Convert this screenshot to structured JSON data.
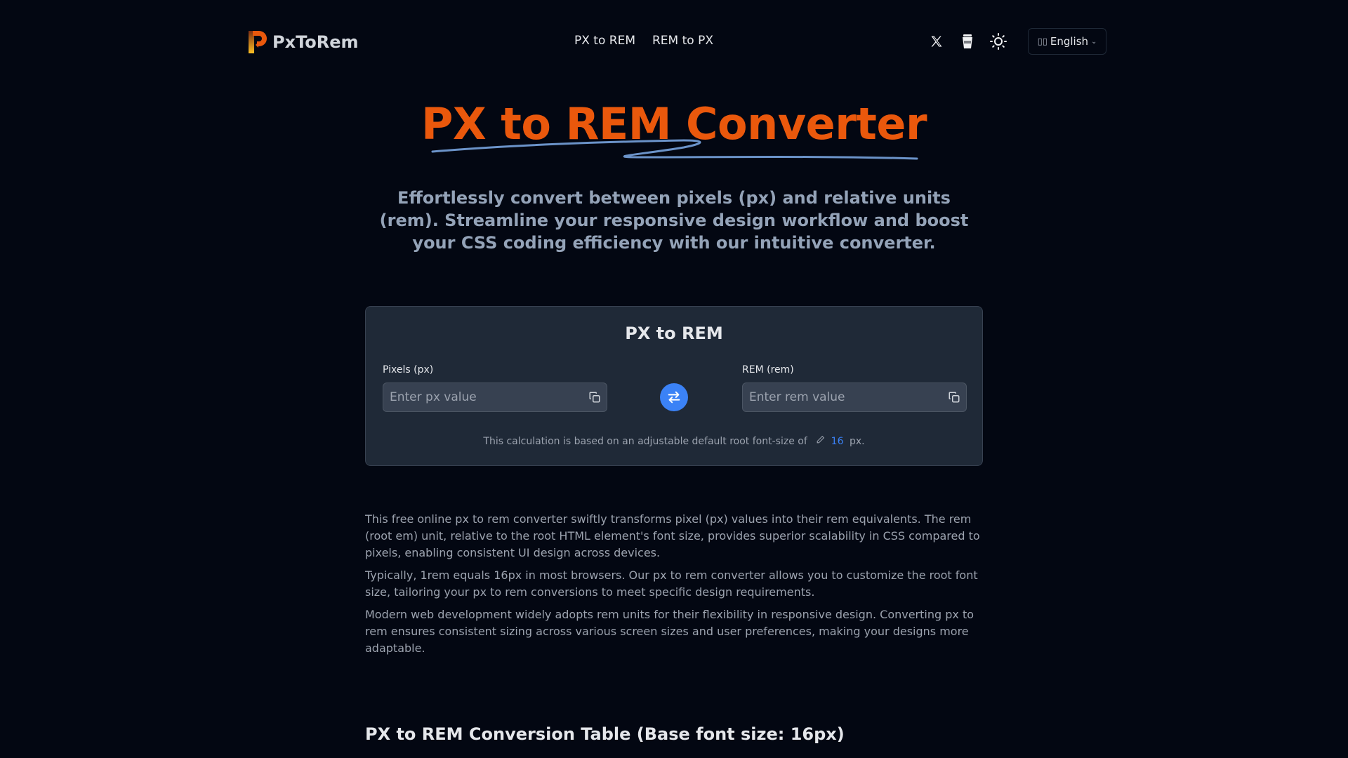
{
  "header": {
    "logo_text": "PxToRem",
    "nav": [
      "PX to REM",
      "REM to PX"
    ],
    "icons": [
      "x-twitter-icon",
      "coffee-cup-icon",
      "sun-icon"
    ],
    "language": "English"
  },
  "hero": {
    "title": "PX to REM Converter",
    "subtitle": "Effortlessly convert between pixels (px) and relative units (rem). Streamline your responsive design workflow and boost your CSS coding efficiency with our intuitive converter."
  },
  "converter": {
    "title": "PX to REM",
    "px_label": "Pixels (px)",
    "px_placeholder": "Enter px value",
    "px_value": "",
    "rem_label": "REM (rem)",
    "rem_placeholder": "Enter rem value",
    "rem_value": "",
    "note_prefix": "This calculation is based on an adjustable default root font-size of",
    "root_font_size": "16",
    "note_suffix": "px.",
    "accent_color": "#3b82f6"
  },
  "description": [
    "This free online px to rem converter swiftly transforms pixel (px) values into their rem equivalents. The rem (root em) unit, relative to the root HTML element's font size, provides superior scalability in CSS compared to pixels, enabling consistent UI design across devices.",
    "Typically, 1rem equals 16px in most browsers. Our px to rem converter allows you to customize the root font size, tailoring your px to rem conversions to meet specific design requirements.",
    "Modern web development widely adopts rem units for their flexibility in responsive design. Converting px to rem ensures consistent sizing across various screen sizes and user preferences, making your designs more adaptable."
  ],
  "table_section": {
    "title": "PX to REM Conversion Table (Base font size: 16px)"
  }
}
